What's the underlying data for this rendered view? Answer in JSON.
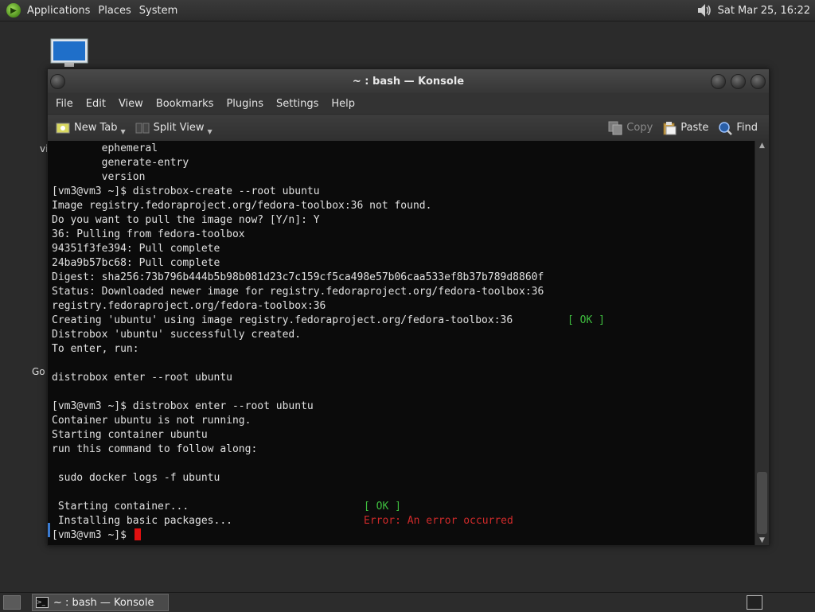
{
  "top_panel": {
    "menus": [
      "Applications",
      "Places",
      "System"
    ],
    "clock": "Sat Mar 25, 16:22"
  },
  "desktop": {
    "label_1": "vi",
    "label_2": "Go"
  },
  "window": {
    "title": "~ : bash — Konsole",
    "menu": [
      "File",
      "Edit",
      "View",
      "Bookmarks",
      "Plugins",
      "Settings",
      "Help"
    ],
    "toolbar": {
      "new_tab": "New Tab",
      "split_view": "Split View",
      "copy": "Copy",
      "paste": "Paste",
      "find": "Find"
    }
  },
  "terminal": {
    "lines": [
      {
        "text": "        ephemeral"
      },
      {
        "text": "        generate-entry"
      },
      {
        "text": "        version"
      },
      {
        "text": "[vm3@vm3 ~]$ distrobox-create --root ubuntu"
      },
      {
        "text": "Image registry.fedoraproject.org/fedora-toolbox:36 not found."
      },
      {
        "text": "Do you want to pull the image now? [Y/n]: Y"
      },
      {
        "text": "36: Pulling from fedora-toolbox"
      },
      {
        "text": "94351f3fe394: Pull complete"
      },
      {
        "text": "24ba9b57bc68: Pull complete"
      },
      {
        "text": "Digest: sha256:73b796b444b5b98b081d23c7c159cf5ca498e57b06caa533ef8b37b789d8860f"
      },
      {
        "text": "Status: Downloaded newer image for registry.fedoraproject.org/fedora-toolbox:36"
      },
      {
        "text": "registry.fedoraproject.org/fedora-toolbox:36"
      },
      {
        "text": "Creating 'ubuntu' using image registry.fedoraproject.org/fedora-toolbox:36",
        "status": "[ OK ]",
        "status_type": "ok",
        "status_col": 81
      },
      {
        "text": "Distrobox 'ubuntu' successfully created."
      },
      {
        "text": "To enter, run:"
      },
      {
        "text": ""
      },
      {
        "text": "distrobox enter --root ubuntu"
      },
      {
        "text": ""
      },
      {
        "text": "[vm3@vm3 ~]$ distrobox enter --root ubuntu"
      },
      {
        "text": "Container ubuntu is not running."
      },
      {
        "text": "Starting container ubuntu"
      },
      {
        "text": "run this command to follow along:"
      },
      {
        "text": ""
      },
      {
        "text": " sudo docker logs -f ubuntu"
      },
      {
        "text": ""
      },
      {
        "text": " Starting container...",
        "status": "[ OK ]",
        "status_type": "ok",
        "status_col": 49
      },
      {
        "text": " Installing basic packages...",
        "status": "Error: An error occurred",
        "status_type": "err",
        "status_col": 49
      },
      {
        "text": "[vm3@vm3 ~]$ ",
        "cursor": true
      }
    ]
  },
  "taskbar": {
    "task_label": "~ : bash — Konsole"
  }
}
